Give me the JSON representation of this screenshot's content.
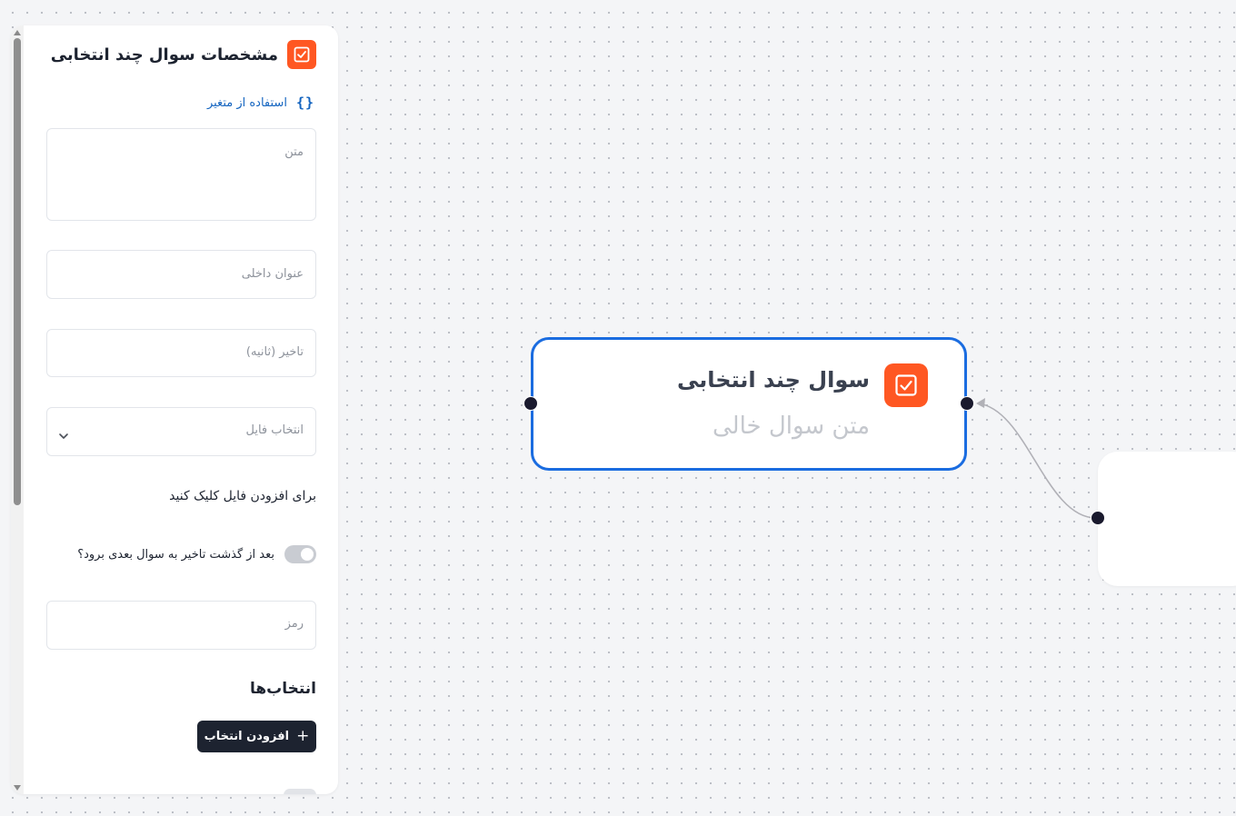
{
  "sidebar": {
    "title": "مشخصات سوال چند انتخابی",
    "use_variable_label": "استفاده از متغیر",
    "use_variable_icon": "{}",
    "text_placeholder": "متن",
    "internal_title_placeholder": "عنوان داخلی",
    "delay_placeholder": "تاخیر (ثانیه)",
    "file_select_placeholder": "انتخاب فایل",
    "add_file_hint": "برای افزودن فایل کلیک کنید",
    "auto_next_label": "بعد از گذشت تاخیر به سوال بعدی برود؟",
    "auto_next_enabled": false,
    "password_placeholder": "رمز",
    "choices_title": "انتخاب‌ها",
    "add_choice_label": "افزودن انتخاب",
    "add_choice_icon": "+"
  },
  "canvas": {
    "node": {
      "title": "سوال چند انتخابی",
      "subtitle": "متن سوال خالی",
      "icon": "checkbox-icon"
    }
  },
  "colors": {
    "accent_orange": "#ff5722",
    "selected_border": "#1a6ce0",
    "link_blue": "#1565c0",
    "dark_button": "#1d2330"
  }
}
